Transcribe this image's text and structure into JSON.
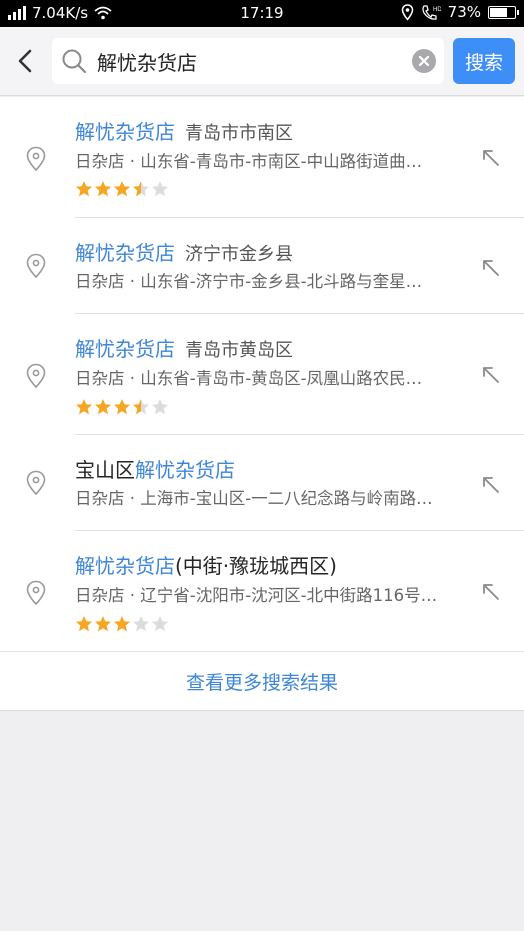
{
  "status_bar": {
    "network_speed": "7.04K/s",
    "time": "17:19",
    "battery": "73%",
    "battery_level": 0.73
  },
  "search": {
    "query": "解忧杂货店",
    "button_label": "搜索"
  },
  "results": [
    {
      "title_prefix": "",
      "title_highlight": "解忧杂货店",
      "title_suffix": "",
      "city": "青岛市市南区",
      "address": "日杂店 · 山东省-青岛市-市南区-中山路街道曲…",
      "rating": 3.5
    },
    {
      "title_prefix": "",
      "title_highlight": "解忧杂货店",
      "title_suffix": "",
      "city": "济宁市金乡县",
      "address": "日杂店 · 山东省-济宁市-金乡县-北斗路与奎星…",
      "rating": null
    },
    {
      "title_prefix": "",
      "title_highlight": "解忧杂货店",
      "title_suffix": "",
      "city": "青岛市黄岛区",
      "address": "日杂店 · 山东省-青岛市-黄岛区-凤凰山路农民…",
      "rating": 3.5
    },
    {
      "title_prefix": "宝山区",
      "title_highlight": "解忧杂货店",
      "title_suffix": "",
      "city": "",
      "address": "日杂店 · 上海市-宝山区-一二八纪念路与岭南路…",
      "rating": null
    },
    {
      "title_prefix": "",
      "title_highlight": "解忧杂货店",
      "title_suffix": "(中街·豫珑城西区)",
      "city": "",
      "address": "日杂店 · 辽宁省-沈阳市-沈河区-北中街路116号…",
      "rating": 3
    }
  ],
  "more_results_label": "查看更多搜索结果",
  "colors": {
    "accent": "#3e8ef7",
    "highlight_text": "#3e86d6",
    "star_filled": "#f5a623",
    "star_empty": "#dcdcdc"
  }
}
